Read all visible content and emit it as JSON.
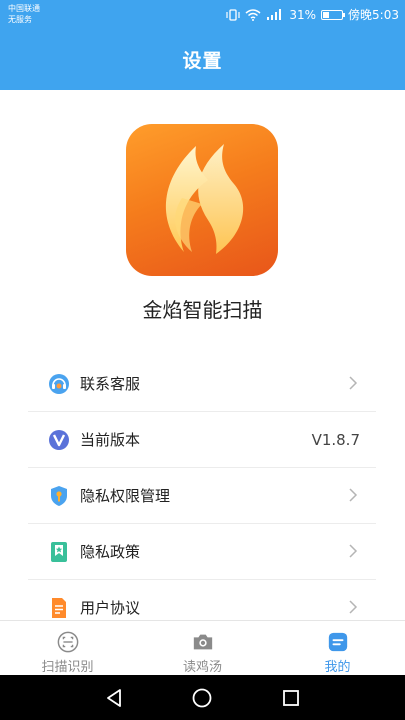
{
  "status_bar": {
    "carrier_line1": "中国联通",
    "carrier_line2": "无服务",
    "battery_percent": "31%",
    "battery_level": 0.31,
    "time": "傍晚5:03"
  },
  "header": {
    "title": "设置"
  },
  "app": {
    "name": "金焰智能扫描"
  },
  "menu": {
    "items": [
      {
        "label": "联系客服",
        "icon": "headset-icon"
      },
      {
        "label": "当前版本",
        "icon": "version-v-icon",
        "value": "V1.8.7"
      },
      {
        "label": "隐私权限管理",
        "icon": "shield-lock-icon"
      },
      {
        "label": "隐私政策",
        "icon": "bookmark-icon"
      },
      {
        "label": "用户协议",
        "icon": "document-icon"
      }
    ]
  },
  "tabbar": {
    "tabs": [
      {
        "label": "扫描识别",
        "icon": "scan-icon",
        "active": false
      },
      {
        "label": "读鸡汤",
        "icon": "camera-icon",
        "active": false
      },
      {
        "label": "我的",
        "icon": "profile-icon",
        "active": true
      }
    ]
  },
  "colors": {
    "primary": "#3fa4ef",
    "active_tab": "#3f97ea",
    "logo_gradient_start": "#ff9d2b",
    "logo_gradient_end": "#e8561a"
  }
}
